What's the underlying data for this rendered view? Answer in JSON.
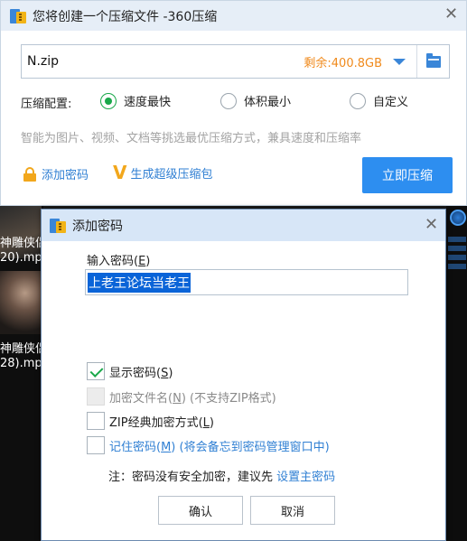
{
  "main_window": {
    "title": "您将创建一个压缩文件 -360压缩",
    "close_glyph": "✕",
    "path_value": "N.zip",
    "free_space": "剩余:400.8GB",
    "config_label": "压缩配置:",
    "options": [
      {
        "label": "速度最快",
        "selected": true
      },
      {
        "label": "体积最小",
        "selected": false
      },
      {
        "label": "自定义",
        "selected": false
      }
    ],
    "hint": "智能为图片、视频、文档等挑选最优压缩方式，兼具速度和压缩率",
    "add_password": "添加密码",
    "super_pack": "生成超级压缩包",
    "compress_button": "立即压缩"
  },
  "background": {
    "label1_line1": "神雕侠侣",
    "label1_line2": "20).mp",
    "label2_line1": "神雕侠侣",
    "label2_line2": "28).mp"
  },
  "password_dialog": {
    "title": "添加密码",
    "close_glyph": "✕",
    "input_label_main": "输入密码(",
    "input_label_key": "E",
    "input_label_end": ")",
    "password_value": "上老王论坛当老王",
    "show_password": {
      "main": "显示密码(",
      "key": "S",
      "end": ")",
      "checked": true
    },
    "encrypt_names": {
      "main": "加密文件名(",
      "key": "N",
      "end": ") (不支持ZIP格式)",
      "checked": false,
      "disabled": true
    },
    "zip_classic": {
      "main": "ZIP经典加密方式(",
      "key": "L",
      "end": ")",
      "checked": false
    },
    "remember": {
      "main": "记住密码(",
      "key": "M",
      "end": ") (将会备忘到密码管理窗口中)",
      "checked": false
    },
    "note_prefix": "注：密码没有安全加密，建议先",
    "note_link": "设置主密码",
    "ok_button": "确认",
    "cancel_button": "取消"
  },
  "colors": {
    "accent_blue": "#2d8ef0",
    "link_blue": "#2f7fd3",
    "check_green": "#19a84a",
    "free_orange": "#f08a1c"
  }
}
